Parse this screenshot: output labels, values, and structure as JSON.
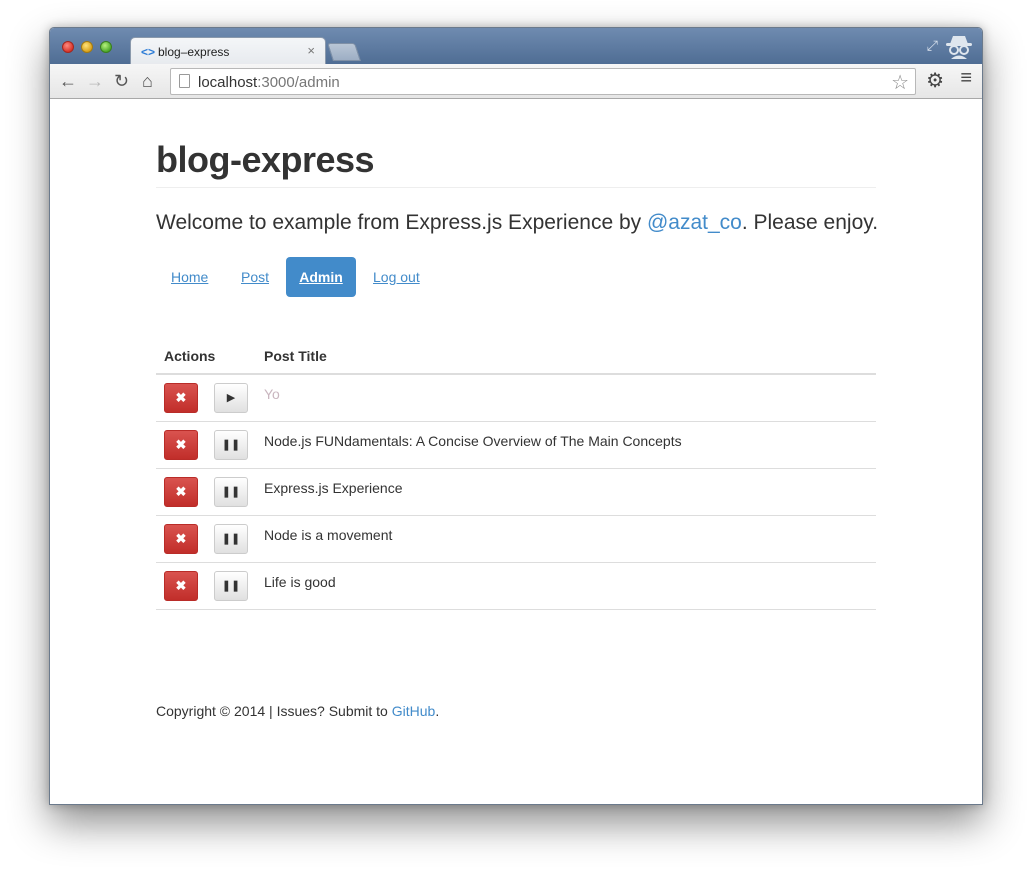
{
  "browser": {
    "tab_title": "blog–express",
    "tab_close": "×",
    "url_host": "localhost",
    "url_path": ":3000/admin"
  },
  "icons": {
    "back": "←",
    "forward": "→",
    "reload": "↻",
    "home": "⌂",
    "star": "☆",
    "gear": "⚙",
    "menu": "≡",
    "fullscreen": "⤢",
    "delete": "✖",
    "play": "▶",
    "pause": "❚❚"
  },
  "site": {
    "title": "blog-express",
    "lead_prefix": "Welcome to example from Express.js Experience by ",
    "lead_link": "@azat_co",
    "lead_suffix": ". Please enjoy."
  },
  "nav": {
    "home": "Home",
    "post": "Post",
    "admin": "Admin",
    "logout": "Log out"
  },
  "table": {
    "col_actions": "Actions",
    "col_title": "Post Title",
    "rows": [
      {
        "title": "Yo",
        "published": false
      },
      {
        "title": "Node.js FUNdamentals: A Concise Overview of The Main Concepts",
        "published": true
      },
      {
        "title": "Express.js Experience",
        "published": true
      },
      {
        "title": "Node is a movement",
        "published": true
      },
      {
        "title": "Life is good",
        "published": true
      }
    ]
  },
  "footer": {
    "prefix": "Copyright © 2014 | Issues? Submit to ",
    "link": "GitHub",
    "suffix": "."
  },
  "colors": {
    "primary": "#428bca",
    "danger": "#d9534f",
    "titlebar": "#5a779e"
  }
}
